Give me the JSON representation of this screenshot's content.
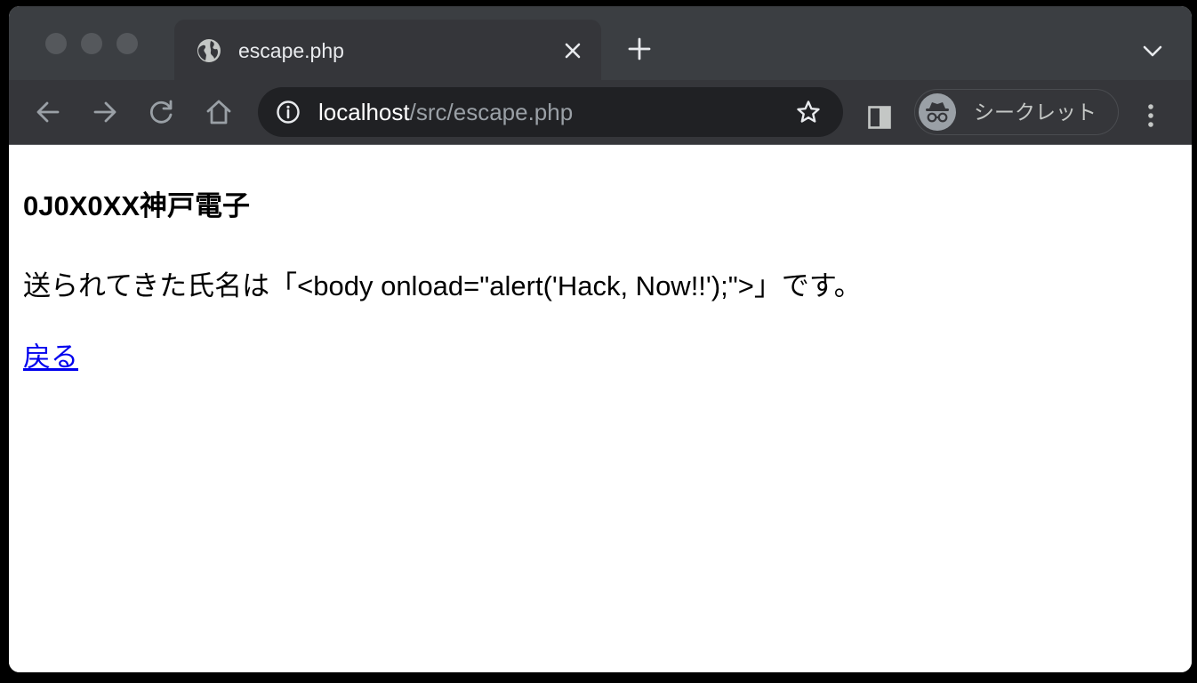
{
  "browser": {
    "tab": {
      "title": "escape.php",
      "icon": "globe-icon"
    },
    "address_bar": {
      "host": "localhost",
      "path": "/src/escape.php"
    },
    "profile_label": "シークレット",
    "colors": {
      "tabstrip": "#3b3e42",
      "toolbar": "#35363a",
      "omnibox": "#202124",
      "icon": "#c4c7c5"
    }
  },
  "page": {
    "heading": "0J0X0XX神戸電子",
    "message": "送られてきた氏名は「<body onload=\"alert('Hack, Now!!');\">」です。",
    "back_link": "戻る",
    "colors": {
      "link": "#0000ee",
      "text": "#000000",
      "background": "#ffffff"
    }
  }
}
